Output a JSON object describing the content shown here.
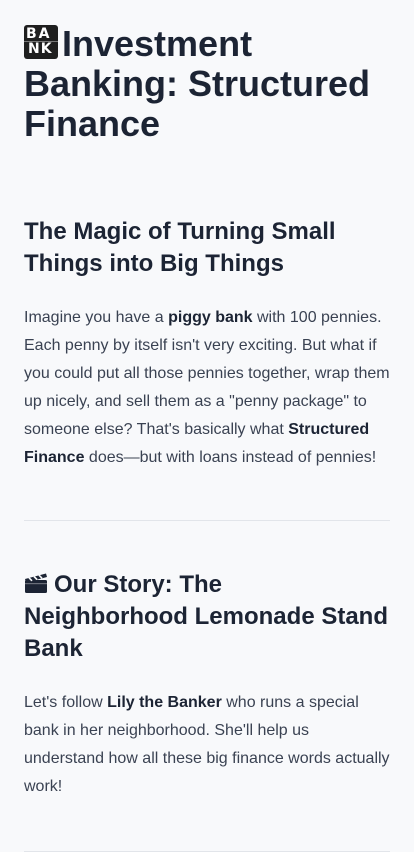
{
  "page": {
    "title": "Investment Banking: Structured Finance",
    "title_icon": "bank-icon",
    "title_icon_text": [
      "BA",
      "NK"
    ]
  },
  "sections": [
    {
      "heading": "The Magic of Turning Small Things into Big Things",
      "paragraph": [
        {
          "text": "Imagine you have a ",
          "bold": false
        },
        {
          "text": "piggy bank",
          "bold": true
        },
        {
          "text": " with 100 pennies. Each penny by itself isn't very exciting. But what if you could put all those pennies together, wrap them up nicely, and sell them as a \"penny package\" to someone else? That's basically what ",
          "bold": false
        },
        {
          "text": "Structured Finance",
          "bold": true
        },
        {
          "text": " does—but with loans instead of pennies!",
          "bold": false
        }
      ]
    },
    {
      "heading_icon": "clapper-board-icon",
      "heading": "Our Story: The Neighborhood Lemonade Stand Bank",
      "paragraph": [
        {
          "text": "Let's follow ",
          "bold": false
        },
        {
          "text": "Lily the Banker",
          "bold": true
        },
        {
          "text": " who runs a special bank in her neighborhood. She'll help us understand how all these big finance words actually work!",
          "bold": false
        }
      ]
    }
  ]
}
